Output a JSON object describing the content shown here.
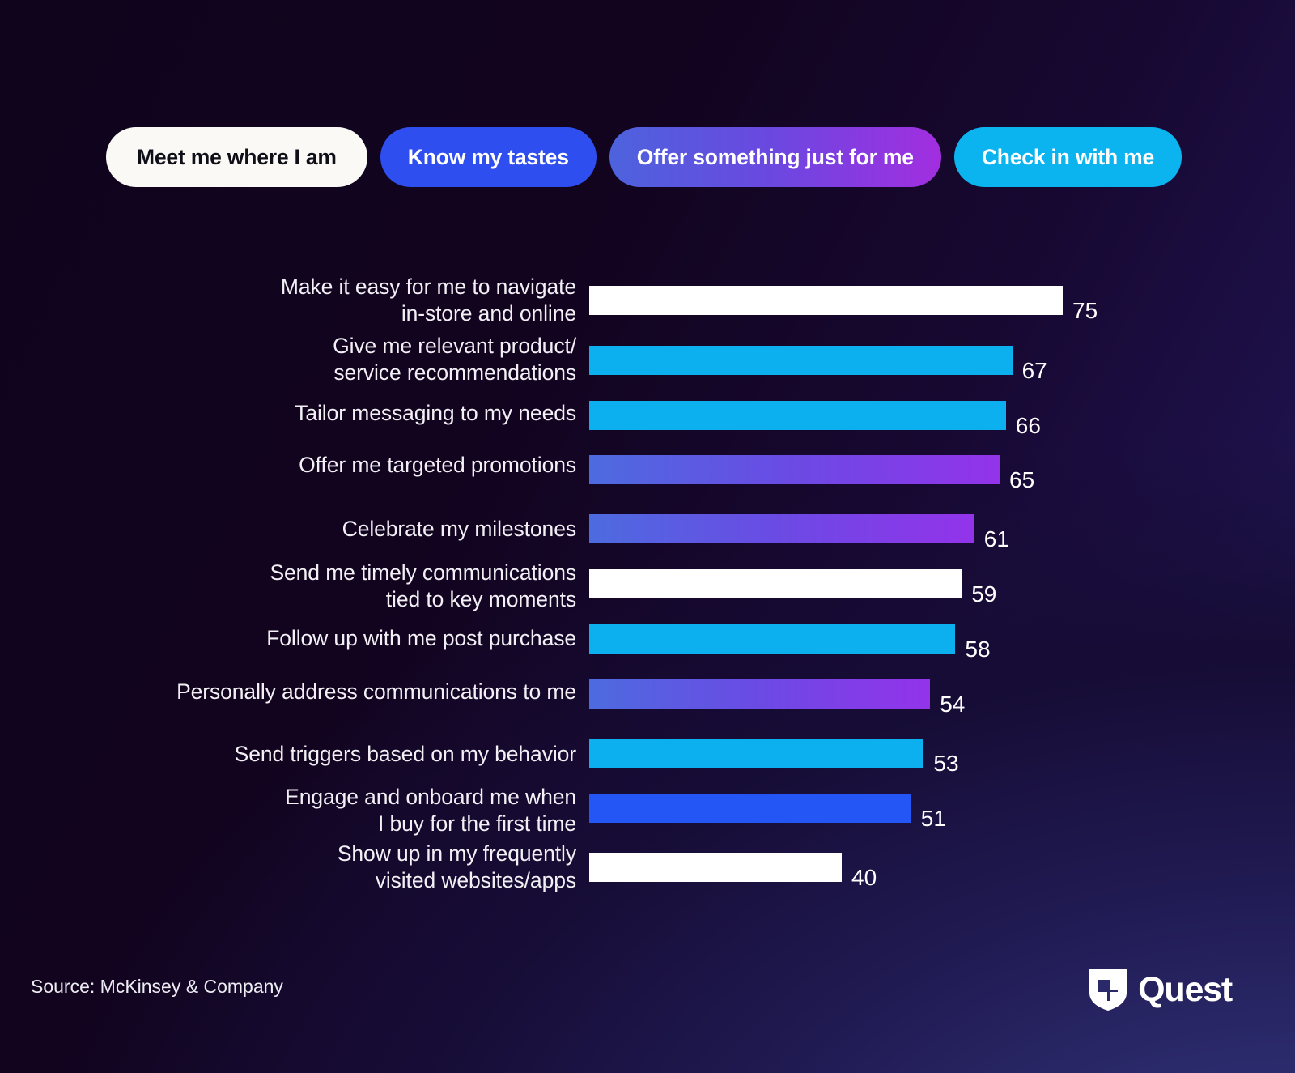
{
  "pills": [
    {
      "label": "Meet me where I am",
      "style": "white"
    },
    {
      "label": "Know my tastes",
      "style": "blue"
    },
    {
      "label": "Offer something just for me",
      "style": "gradient-purple"
    },
    {
      "label": "Check in with me",
      "style": "cyan"
    }
  ],
  "footer": {
    "source": "Source: McKinsey & Company",
    "logo_word": "Quest",
    "logo_mark": "quest-shield-icon"
  },
  "colors": {
    "white": "#ffffff",
    "cyan": "#0cb0ee",
    "blue": "#2456f5",
    "gradient_start": "#4d6be0",
    "gradient_end": "#9333ea",
    "background_start": "#10031c",
    "background_end": "#2a2a6b"
  },
  "chart_data": {
    "type": "bar",
    "orientation": "horizontal",
    "title": "",
    "xlabel": "",
    "ylabel": "",
    "xlim": [
      0,
      80
    ],
    "grid": false,
    "legend": "none",
    "value_label_position": "outside-end",
    "categories": [
      "Make it easy for me to navigate in-store and online",
      "Give me relevant product/service recommendations",
      "Tailor messaging to my needs",
      "Offer me targeted promotions",
      "Celebrate my milestones",
      "Send me timely communications tied to key moments",
      "Follow up with me post purchase",
      "Personally address communications to me",
      "Send triggers based on my behavior",
      "Engage and onboard me when I buy for the first time",
      "Show up in my frequently visited websites/apps"
    ],
    "values": [
      75,
      67,
      66,
      65,
      61,
      59,
      58,
      54,
      53,
      51,
      40
    ],
    "bars": [
      {
        "label_line1": "Make it easy for me to navigate",
        "label_line2": "in-store and online",
        "value": 75,
        "color": "white"
      },
      {
        "label_line1": "Give me relevant product/",
        "label_line2": "service recommendations",
        "value": 67,
        "color": "cyan"
      },
      {
        "label_line1": "Tailor messaging to my needs",
        "label_line2": "",
        "value": 66,
        "color": "cyan"
      },
      {
        "label_line1": "Offer me targeted promotions",
        "label_line2": "",
        "value": 65,
        "color": "gradient"
      },
      {
        "label_line1": "Celebrate my milestones",
        "label_line2": "",
        "value": 61,
        "color": "gradient"
      },
      {
        "label_line1": "Send me timely communications",
        "label_line2": "tied to key moments",
        "value": 59,
        "color": "white"
      },
      {
        "label_line1": "Follow up with me post purchase",
        "label_line2": "",
        "value": 58,
        "color": "cyan"
      },
      {
        "label_line1": "Personally address communications to me",
        "label_line2": "",
        "value": 54,
        "color": "gradient"
      },
      {
        "label_line1": "Send triggers based on my behavior",
        "label_line2": "",
        "value": 53,
        "color": "cyan"
      },
      {
        "label_line1": "Engage and onboard me when",
        "label_line2": "I buy for the first time",
        "value": 51,
        "color": "blue"
      },
      {
        "label_line1": "Show up in my frequently",
        "label_line2": "visited websites/apps",
        "value": 40,
        "color": "white"
      }
    ]
  }
}
